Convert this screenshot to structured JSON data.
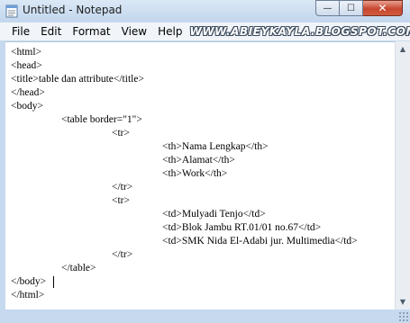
{
  "window": {
    "title": "Untitled - Notepad",
    "buttons": {
      "minimize": "—",
      "maximize": "☐",
      "close": "✕"
    }
  },
  "menu": {
    "items": [
      "File",
      "Edit",
      "Format",
      "View",
      "Help"
    ],
    "watermark": "WWW.ABIEYKAYLA.BLOGSPOT.COM"
  },
  "editor": {
    "lines": [
      "<html>",
      "<head>",
      "<title>table dan attribute</title>",
      "</head>",
      "<body>",
      "\t\t<table border=\"1\">",
      "\t\t\t\t<tr>",
      "\t\t\t\t\t\t<th>Nama Lengkap</th>",
      "\t\t\t\t\t\t<th>Alamat</th>",
      "\t\t\t\t\t\t<th>Work</th>",
      "\t\t\t\t</tr>",
      "\t\t\t\t<tr>",
      "\t\t\t\t\t\t<td>Mulyadi Tenjo</td>",
      "\t\t\t\t\t\t<td>Blok Jambu RT.01/01 no.67</td>",
      "\t\t\t\t\t\t<td>SMK Nida El-Adabi jur. Multimedia</td>",
      "\t\t\t\t</tr>",
      "\t\t</table>",
      "</body>",
      "</html>"
    ]
  },
  "scrollbar": {
    "up": "▲",
    "down": "▼"
  }
}
